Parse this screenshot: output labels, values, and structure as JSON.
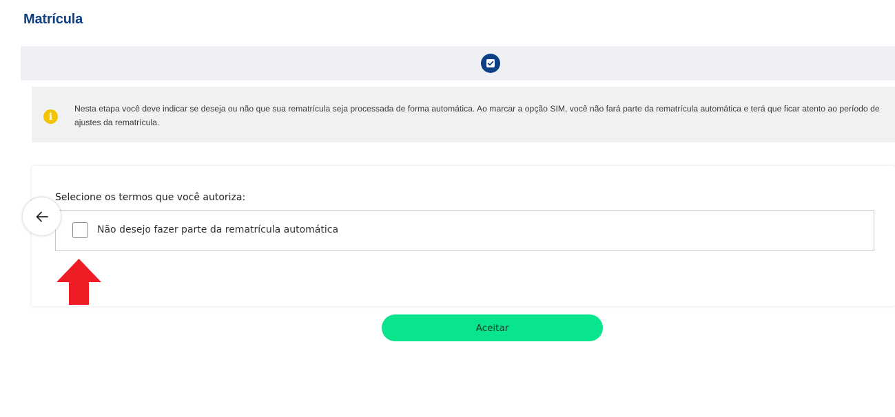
{
  "header": {
    "title": "Matrícula"
  },
  "stepper": {
    "icon": "checkbox-checked-icon",
    "color": "#0d3f85"
  },
  "info": {
    "icon": "info-icon",
    "icon_glyph": "i",
    "icon_color": "#f5c400",
    "text": "Nesta etapa você deve indicar se deseja ou não que sua rematrícula seja processada de forma automática. Ao marcar a opção SIM, você não fará parte da rematrícula automática e terá que ficar atento ao período de ajustes da rematrícula."
  },
  "terms": {
    "label": "Selecione os termos que você autoriza:",
    "options": [
      {
        "label": "Não desejo fazer parte da rematrícula automática",
        "checked": false
      }
    ]
  },
  "navigation": {
    "back_icon": "arrow-left-icon"
  },
  "annotation": {
    "icon": "red-up-arrow-icon",
    "color": "#ee1c24"
  },
  "actions": {
    "accept_label": "Aceitar",
    "accept_color": "#08e58d"
  }
}
